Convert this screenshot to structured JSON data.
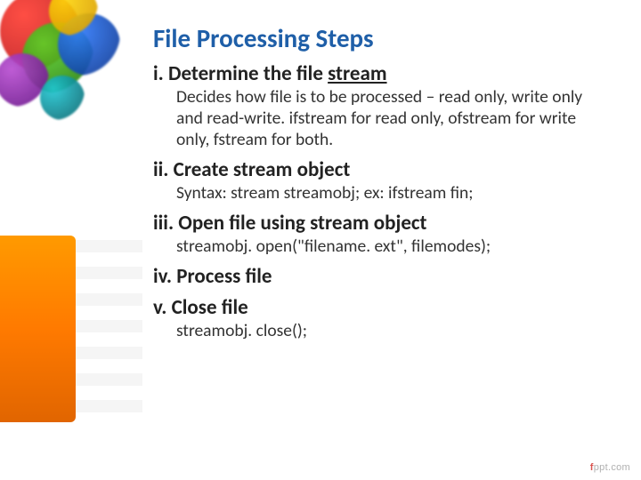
{
  "title": "File Processing Steps",
  "steps": {
    "s1": {
      "head_prefix": "i. Determine the file ",
      "head_underlined": "stream",
      "body": "Decides how file is to be processed – read only, write only and read-write. ifstream for read only, ofstream for write only, fstream for both."
    },
    "s2": {
      "head": "ii. Create stream object",
      "body": "Syntax: stream   streamobj; ex: ifstream fin;"
    },
    "s3": {
      "head": "iii. Open file using stream object",
      "body": "streamobj. open(\"filename. ext\", filemodes);"
    },
    "s4": {
      "head": "iv. Process file"
    },
    "s5": {
      "head": "v. Close file",
      "body": "streamobj. close();"
    }
  },
  "footer": {
    "brand_initial": "f",
    "brand_rest": "ppt.com"
  }
}
